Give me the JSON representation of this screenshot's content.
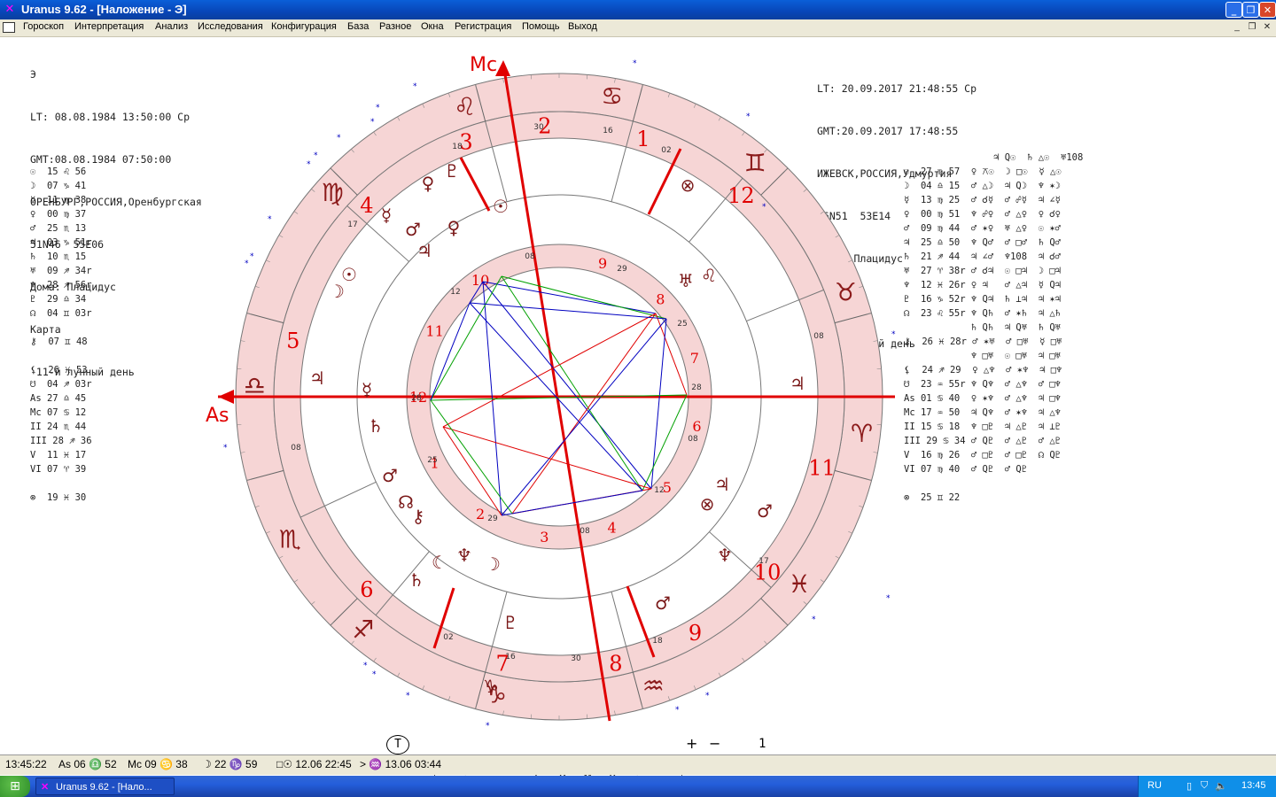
{
  "window": {
    "title": "Uranus 9.62 - [Наложение  - Э]"
  },
  "menu": [
    "Гороскоп",
    "Интерпретация",
    "Анализ",
    "Исследования",
    "Конфигурация",
    "База",
    "Разное",
    "Окна",
    "Регистрация",
    "Помощь",
    "Выход"
  ],
  "left_info": {
    "name": "Э",
    "lt": "LT: 08.08.1984 13:50:00 Ср",
    "gmt": "GMT:08.08.1984 07:50:00",
    "place": "ОРЕНБУРГ,РОССИЯ,Оренбургская",
    "coords": "51N46  55E06",
    "houses": "Дома: Плацидус",
    "chart_type": "Карта",
    "lunar_day": " 11-й лунный день"
  },
  "right_info": {
    "lt": "LT: 20.09.2017 21:48:55 Ср",
    "gmt": "GMT:20.09.2017 17:48:55",
    "place": "ИЖЕВСК,РОССИЯ,Удмуртия",
    "coords": "56N51  53E14",
    "houses": "Дома: Плацидус",
    "chart_type": "Транзит",
    "lunar_day": " 1-й лунный день"
  },
  "left_positions": [
    "☉  15 ♌ 56",
    "☽  07 ♑ 41",
    "☿  11 ♍ 38",
    "♀  00 ♍ 37",
    "♂  25 ♏ 13",
    "♃  03 ♑ 51r",
    "♄  10 ♏ 15",
    "♅  09 ♐ 34r",
    "♆  28 ♐ 56r",
    "♇  29 ♎ 34",
    "☊  04 ♊ 03r",
    "",
    "⚷  07 ♊ 48",
    "",
    "⚸  26 ♓ 53",
    "☋  04 ♐ 03r",
    "As 27 ♎ 45",
    "Mc 07 ♋ 12",
    "II 24 ♏ 44",
    "III 28 ♐ 36",
    "V  11 ♓ 17",
    "VI 07 ♈ 39",
    "",
    "⊗  19 ♓ 30"
  ],
  "right_positions": [
    "                ♃ Q☉  ♄ △☉  ♅108",
    "☉  27 ♍ 57  ♀ ⚻☉  ☽ □☉  ☿ △☉",
    "☽  04 ♎ 15  ♂ △☽  ♃ Q☽  ♆ ✶☽",
    "☿  13 ♍ 25  ♂ ☌☿  ♂ ☍☿  ♃ ∠☿",
    "♀  00 ♍ 51  ♆ ☍♀  ♂ △♀  ♀ ☌♀",
    "♂  09 ♍ 44  ♂ ✶♀  ♅ △♀  ☉ ✶♂",
    "♃  25 ♎ 50  ♆ Q♂  ♂ □♂  ♄ Q♂",
    "♄  21 ♐ 44  ♃ ∠♂  ♆108  ♃ ☌♂",
    "♅  27 ♈ 38r ♂ ☌♃  ☉ □♃  ☽ □♃",
    "♆  12 ♓ 26r ♀ ♃   ♂ △♃  ☿ Q♃",
    "♇  16 ♑ 52r ♆ Q♃  ♄ ⊥♃  ♃ ✶♃",
    "☊  23 ♌ 55r ♆ Q♄  ♂ ✶♄  ♃ △♄",
    "            ♄ Q♄  ♃ Q♅  ♄ Q♅",
    "⚷  26 ♓ 28r ♂ ✶♅  ♂ □♅  ☿ □♅",
    "            ♆ □♅  ☉ □♅  ♃ □♅",
    "⚸  24 ♐ 29  ♀ △♆  ♂ ✶♆  ♃ □♆",
    "☋  23 ♒ 55r ♆ Q♆  ♂ △♆  ♂ □♆",
    "As 01 ♋ 40  ♀ ✶♆  ♂ △♆  ♃ □♆",
    "Mc 17 ♒ 50  ♃ Q♆  ♂ ✶♆  ♃ △♆",
    "II 15 ♋ 18  ♆ □♇  ♃ △♇  ♃ ⊥♇",
    "III 29 ♋ 34 ♂ Q♇  ♂ △♇  ♂ △♇",
    "V  16 ♍ 26  ♂ □♇  ♂ □♇  ☊ Q♇",
    "VI 07 ♍ 40  ♂ Q♇  ♂ Q♇",
    "",
    "⊗  25 ♊ 22"
  ],
  "navbar": {
    "items": [
      "<",
      "⊕",
      "s",
      "m",
      "h",
      "D",
      "M",
      "Y",
      "⊕",
      ">"
    ],
    "plus": "+",
    "minus": "−",
    "step": "1",
    "t_label": "T"
  },
  "status": {
    "time": "13:45:22",
    "as": "As 06 ♎ 52",
    "mc": "Mc 09 ♋ 38",
    "moon": "☽ 22 ♑ 59",
    "event1": "□☉ 12.06 22:45",
    "event2": "> ♒ 13.06 03:44"
  },
  "taskbar": {
    "item": "Uranus 9.62 - [Нало...",
    "lang": "RU",
    "clock": "13:45"
  },
  "colors": {
    "accent_red": "#e00000",
    "ring_fill": "#f6d5d5",
    "green": "#0a0",
    "blue": "#0000c0"
  }
}
